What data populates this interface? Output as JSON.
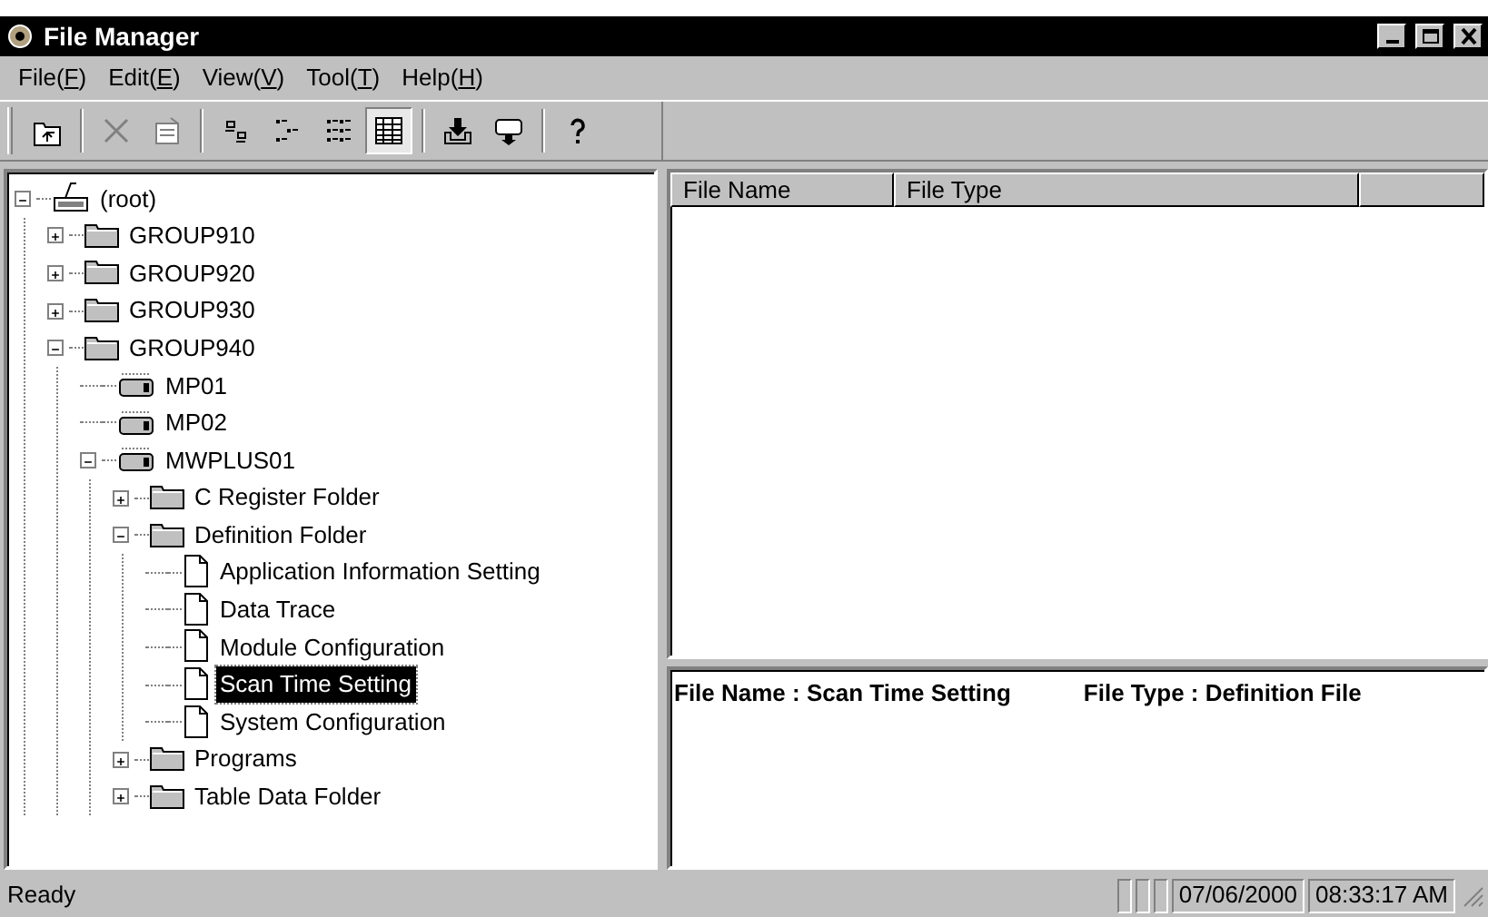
{
  "window": {
    "title": "File Manager"
  },
  "menu": [
    {
      "before": "File(",
      "key": "F",
      "after": ")"
    },
    {
      "before": "Edit(",
      "key": "E",
      "after": ")"
    },
    {
      "before": "View(",
      "key": "V",
      "after": ")"
    },
    {
      "before": "Tool(",
      "key": "T",
      "after": ")"
    },
    {
      "before": "Help(",
      "key": "H",
      "after": ")"
    }
  ],
  "toolbar": [
    {
      "kind": "up",
      "disabled": false,
      "selected": false
    },
    {
      "kind": "sep"
    },
    {
      "kind": "delete",
      "disabled": true,
      "selected": false
    },
    {
      "kind": "properties",
      "disabled": true,
      "selected": false
    },
    {
      "kind": "sep"
    },
    {
      "kind": "large",
      "disabled": false,
      "selected": false
    },
    {
      "kind": "small",
      "disabled": false,
      "selected": false
    },
    {
      "kind": "list",
      "disabled": false,
      "selected": false
    },
    {
      "kind": "details",
      "disabled": false,
      "selected": true
    },
    {
      "kind": "sep"
    },
    {
      "kind": "download",
      "disabled": false,
      "selected": false
    },
    {
      "kind": "upload",
      "disabled": false,
      "selected": false
    },
    {
      "kind": "sep"
    },
    {
      "kind": "help",
      "disabled": false,
      "selected": false
    }
  ],
  "tree": [
    {
      "label": "(root)",
      "kind": "root",
      "expanded": true,
      "selected": false,
      "children": [
        {
          "label": "GROUP910",
          "kind": "folder",
          "expanded": false,
          "selected": false
        },
        {
          "label": "GROUP920",
          "kind": "folder",
          "expanded": false,
          "selected": false
        },
        {
          "label": "GROUP930",
          "kind": "folder",
          "expanded": false,
          "selected": false
        },
        {
          "label": "GROUP940",
          "kind": "folder",
          "expanded": true,
          "selected": false,
          "children": [
            {
              "label": "MP01",
              "kind": "device",
              "selected": false
            },
            {
              "label": "MP02",
              "kind": "device",
              "selected": false
            },
            {
              "label": "MWPLUS01",
              "kind": "device",
              "expanded": true,
              "selected": false,
              "children": [
                {
                  "label": "C Register Folder",
                  "kind": "folder",
                  "expanded": false,
                  "selected": false
                },
                {
                  "label": "Definition Folder",
                  "kind": "folder",
                  "expanded": true,
                  "selected": false,
                  "children": [
                    {
                      "label": "Application Information Setting",
                      "kind": "file",
                      "selected": false
                    },
                    {
                      "label": "Data Trace",
                      "kind": "file",
                      "selected": false
                    },
                    {
                      "label": "Module Configuration",
                      "kind": "file",
                      "selected": false
                    },
                    {
                      "label": "Scan Time Setting",
                      "kind": "file",
                      "selected": true
                    },
                    {
                      "label": "System Configuration",
                      "kind": "file",
                      "selected": false
                    }
                  ]
                },
                {
                  "label": "Programs",
                  "kind": "folder",
                  "expanded": false,
                  "selected": false
                },
                {
                  "label": "Table Data Folder",
                  "kind": "folder",
                  "expanded": false,
                  "selected": false
                }
              ]
            }
          ]
        }
      ]
    }
  ],
  "file_list": {
    "columns": [
      "File Name",
      "File Type"
    ]
  },
  "info": {
    "file_name": "File Name : Scan Time Setting",
    "file_type": "File Type : Definition File"
  },
  "status_bar": {
    "message": "Ready",
    "date": "07/06/2000",
    "time": "08:33:17 AM"
  }
}
